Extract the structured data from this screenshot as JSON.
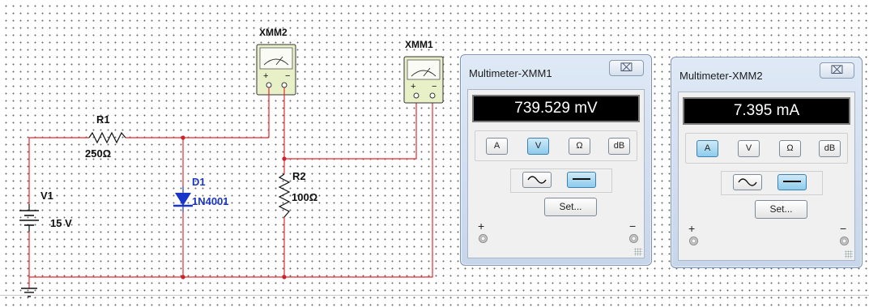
{
  "schematic": {
    "source": {
      "ref": "V1",
      "value": "15 V"
    },
    "resistor1": {
      "ref": "R1",
      "value": "250Ω"
    },
    "diode": {
      "ref": "D1",
      "part": "1N4001"
    },
    "resistor2": {
      "ref": "R2",
      "value": "100Ω"
    },
    "meter_symbols": [
      {
        "ref": "XMM2"
      },
      {
        "ref": "XMM1"
      }
    ]
  },
  "panels": [
    {
      "title": "Multimeter-XMM1",
      "close_glyph": "⌧",
      "reading": "739.529 mV",
      "modes": [
        "A",
        "V",
        "Ω",
        "dB"
      ],
      "active_mode": "V",
      "set_label": "Set...",
      "plus": "+",
      "minus": "−"
    },
    {
      "title": "Multimeter-XMM2",
      "close_glyph": "⌧",
      "reading": "7.395 mA",
      "modes": [
        "A",
        "V",
        "Ω",
        "dB"
      ],
      "active_mode": "A",
      "set_label": "Set...",
      "plus": "+",
      "minus": "−"
    }
  ],
  "colors": {
    "wire": "#e8282a",
    "diode": "#1a35c9",
    "junction": "#d0202a"
  }
}
